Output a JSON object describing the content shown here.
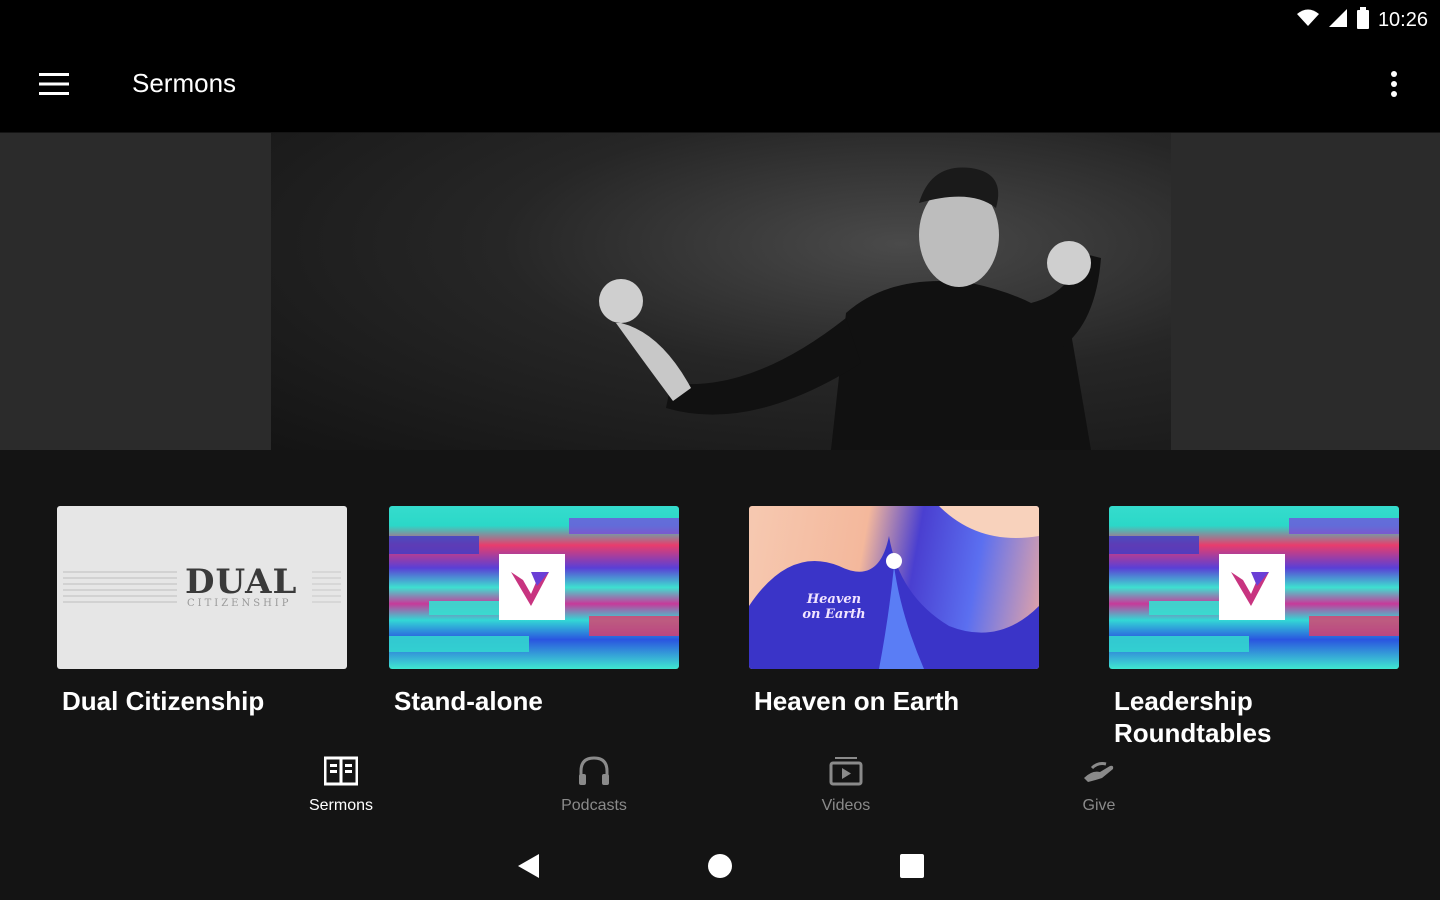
{
  "status_bar": {
    "time": "10:26",
    "icons": [
      "wifi-icon",
      "cell-signal-icon",
      "battery-icon"
    ]
  },
  "app_bar": {
    "title": "Sermons",
    "menu_icon": "hamburger-menu-icon",
    "overflow_icon": "more-vert-icon"
  },
  "cards": [
    {
      "title": "Dual Citizenship",
      "thumb_text": "DUAL",
      "thumb_subtext": "CITIZENSHIP"
    },
    {
      "title": "Stand-alone"
    },
    {
      "title": "Heaven on Earth",
      "thumb_text": "Heaven on Earth"
    },
    {
      "title": "Leadership Roundtables"
    }
  ],
  "bottom_nav": [
    {
      "label": "Sermons",
      "icon": "book-icon",
      "active": true
    },
    {
      "label": "Podcasts",
      "icon": "headphones-icon",
      "active": false
    },
    {
      "label": "Videos",
      "icon": "video-library-icon",
      "active": false
    },
    {
      "label": "Give",
      "icon": "give-hand-icon",
      "active": false
    }
  ],
  "colors": {
    "background": "#141414",
    "app_bar": "#000000",
    "nav_active": "#ffffff",
    "nav_inactive": "#8a8a8a"
  }
}
